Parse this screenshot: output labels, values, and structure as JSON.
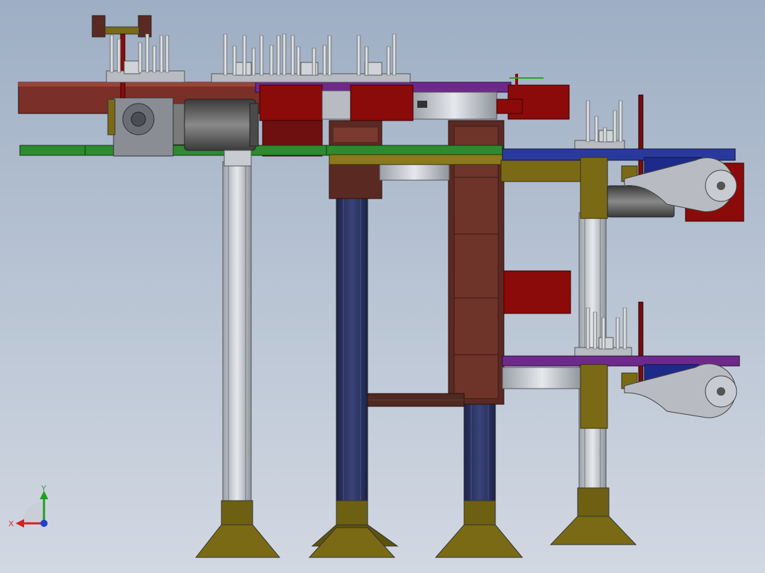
{
  "viewport": {
    "background_top": "#9eaec4",
    "background_bottom": "#d2d8e2"
  },
  "triad": {
    "x_label": "X",
    "y_label": "Y",
    "x_color": "#d42020",
    "y_color": "#20a020",
    "z_color": "#2040d0"
  },
  "colors": {
    "steel": "#c8ccd2",
    "red": "#8b0a0a",
    "brown": "#7a3028",
    "green": "#2e8a2e",
    "navy": "#2c3563",
    "blue": "#2a3a9c",
    "olive": "#7a6a16",
    "motor": "#5a5a5a",
    "purple": "#6e2a8a"
  }
}
